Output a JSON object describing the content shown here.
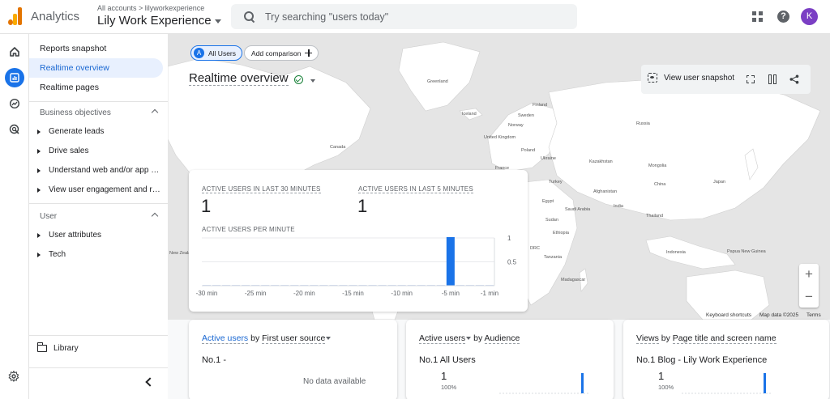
{
  "header": {
    "app_name": "Analytics",
    "breadcrumb": "All accounts > lilyworkexperience",
    "property": "Lily Work Experience",
    "search_placeholder": "Try searching \"users today\"",
    "avatar_initial": "K"
  },
  "nav": {
    "items": [
      "Reports snapshot",
      "Realtime overview",
      "Realtime pages"
    ],
    "active": "Realtime overview",
    "business_section": "Business objectives",
    "business_items": [
      "Generate leads",
      "Drive sales",
      "Understand web and/or app traffic",
      "View user engagement and retention"
    ],
    "user_section": "User",
    "user_items": [
      "User attributes",
      "Tech"
    ],
    "library": "Library"
  },
  "main": {
    "comparison_chip": "All Users",
    "comparison_chip_letter": "A",
    "add_comparison": "Add comparison",
    "title": "Realtime overview",
    "view_snapshot": "View user snapshot",
    "zoom_in": "+",
    "zoom_out": "−",
    "map_footer": [
      "Keyboard shortcuts",
      "Map data ©2025",
      "Terms"
    ],
    "map_labels": [
      "Greenland",
      "Iceland",
      "Canada",
      "Sweden",
      "Finland",
      "Norway",
      "United Kingdom",
      "Poland",
      "Ukraine",
      "France",
      "Russia",
      "Kazakhstan",
      "Mongolia",
      "China",
      "Turkey",
      "Afghanistan",
      "Egypt",
      "Saudi Arabia",
      "India",
      "Thailand",
      "Sudan",
      "Ethiopia",
      "DRC",
      "Indonesia",
      "Madagascar",
      "Tanzania",
      "Japan",
      "Papua New Guinea",
      "New Zealand"
    ]
  },
  "realtime_card": {
    "metric1_label": "ACTIVE USERS IN LAST 30 MINUTES",
    "metric1_value": "1",
    "metric2_label": "ACTIVE USERS IN LAST 5 MINUTES",
    "metric2_value": "1",
    "per_minute_label": "ACTIVE USERS PER MINUTE"
  },
  "chart_data": {
    "type": "bar",
    "categories": [
      "-30 min",
      "-25 min",
      "-20 min",
      "-15 min",
      "-10 min",
      "-5 min",
      "-1 min"
    ],
    "x": [
      -30,
      -29,
      -28,
      -27,
      -26,
      -25,
      -24,
      -23,
      -22,
      -21,
      -20,
      -19,
      -18,
      -17,
      -16,
      -15,
      -14,
      -13,
      -12,
      -11,
      -10,
      -9,
      -8,
      -7,
      -6,
      -5,
      -4,
      -3,
      -2,
      -1
    ],
    "values": [
      0,
      0,
      0,
      0,
      0,
      0,
      0,
      0,
      0,
      0,
      0,
      0,
      0,
      0,
      0,
      0,
      0,
      0,
      0,
      0,
      0,
      0,
      0,
      0,
      0,
      1,
      0,
      0,
      0,
      0
    ],
    "yticks": [
      "1",
      "0.5"
    ],
    "ylim": [
      0,
      1
    ],
    "color": "#1a73e8"
  },
  "cards": [
    {
      "metric": "Active users",
      "by": "by",
      "dimension": "First user source",
      "rank": "No.1",
      "rank_value": "-",
      "empty": "No data available"
    },
    {
      "metric": "Active users",
      "by": "by",
      "dimension": "Audience",
      "rank": "No.1",
      "rank_value": "All Users",
      "value": "1",
      "pct": "100%"
    },
    {
      "metric": "Views",
      "by": "by",
      "dimension": "Page title and screen name",
      "rank": "No.1",
      "rank_value": "Blog - Lily Work Experience",
      "value": "1",
      "pct": "100%"
    }
  ],
  "colors": {
    "accent": "#1a73e8",
    "active_nav_bg": "#e8f0fe",
    "map_land": "#ffffff",
    "map_sea": "#e5e5e5"
  }
}
